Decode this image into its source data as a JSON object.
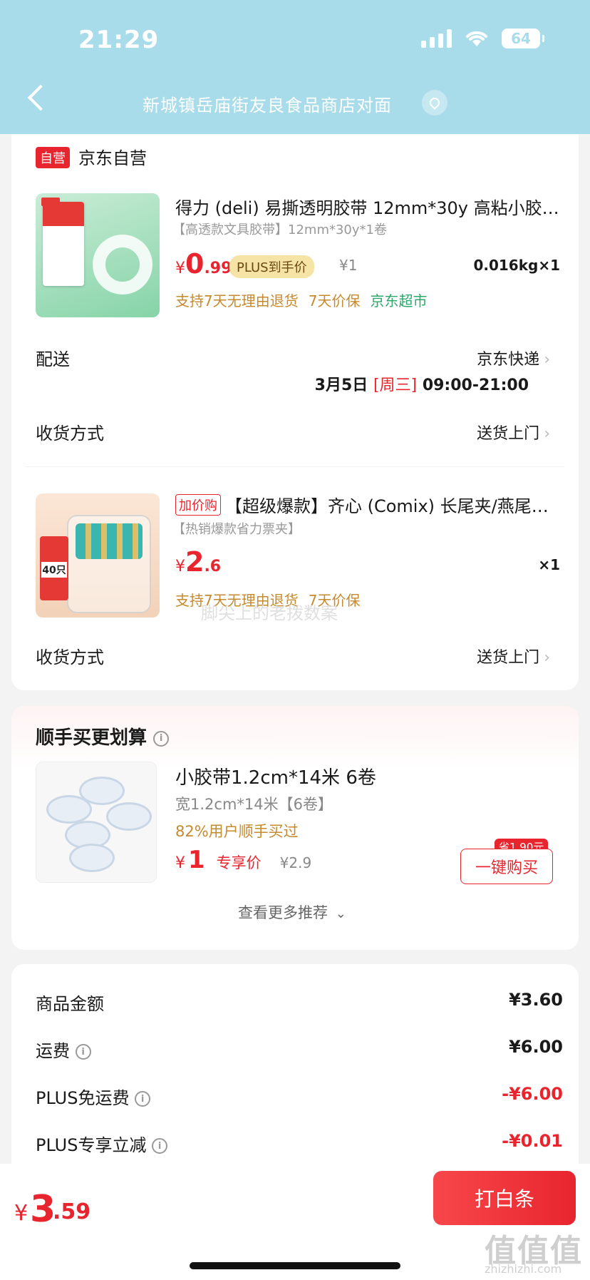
{
  "status_bar": {
    "time": "21:29",
    "battery": "64"
  },
  "nav": {
    "title": "新城镇岳庙街友良食品商店对面"
  },
  "store": {
    "badge": "自营",
    "name": "京东自营"
  },
  "item1": {
    "title": "得力 (deli) 易撕透明胶带 12mm*30y 高粘小胶…",
    "spec": "【高透款文具胶带】12mm*30y*1卷",
    "price_yen": "¥",
    "price_int": "0",
    "price_dec": ".99",
    "plus_label": "PLUS到手价",
    "orig_price": "¥1",
    "weight_qty": "0.016kg×1",
    "services": [
      "支持7天无理由退货",
      "7天价保",
      "京东超市"
    ],
    "image_box_label": "文具胶带"
  },
  "delivery": {
    "label": "配送",
    "value": "京东快递",
    "date": "3月5日",
    "weekday": "[周三]",
    "time_range": "09:00-21:00"
  },
  "receive1": {
    "label": "收货方式",
    "value": "送货上门"
  },
  "item2": {
    "badge": "加价购",
    "title": "【超级爆款】齐心 (Comix) 长尾夹/燕尾…",
    "spec": "【热销爆款省力票夹】",
    "price_yen": "¥",
    "price_int": "2",
    "price_dec": ".6",
    "qty": "×1",
    "services": [
      "支持7天无理由退货",
      "7天价保"
    ],
    "image_tag": "40只"
  },
  "receive2": {
    "label": "收货方式",
    "value": "送货上门"
  },
  "recommend": {
    "section_title": "顺手买更划算",
    "title": "小胶带1.2cm*14米 6卷",
    "spec": "宽1.2cm*14米【6卷】",
    "social": "82%用户顺手买过",
    "price_yen": "¥",
    "price": "1",
    "price_label": "专享价",
    "orig_price": "¥2.9",
    "save_tag": "省1.90元",
    "buy_label": "一键购买",
    "more_label": "查看更多推荐"
  },
  "summary": [
    {
      "label": "商品金额",
      "value": "¥3.60",
      "info": false,
      "red": false
    },
    {
      "label": "运费",
      "value": "¥6.00",
      "info": true,
      "red": false
    },
    {
      "label": "PLUS免运费",
      "value": "-¥6.00",
      "info": true,
      "red": true
    },
    {
      "label": "PLUS专享立减",
      "value": "-¥0.01",
      "info": true,
      "red": true
    }
  ],
  "footer": {
    "total_yen": "¥",
    "total_int": "3",
    "total_dec": ".59",
    "pay_label": "打白条",
    "watermark": "值值值",
    "watermark_sub": "zhizhizhi.com"
  },
  "image_watermark": "脚尖上的老拨数案",
  "colors": {
    "header": "#a8dcea",
    "accent_red": "#e8252e",
    "service_orange": "#c68a2e",
    "service_green": "#2ba86a"
  }
}
